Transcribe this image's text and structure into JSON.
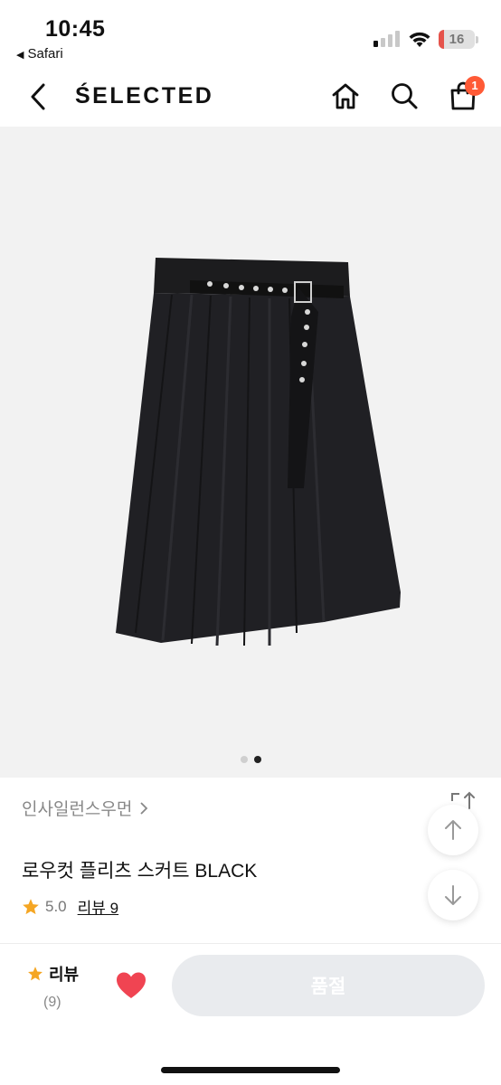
{
  "status_bar": {
    "time": "10:45",
    "back_app": "Safari",
    "battery": "16"
  },
  "header": {
    "brand": "ŚELECTED",
    "cart_badge": "1",
    "icons": [
      "chevron-left-icon",
      "home-icon",
      "search-icon",
      "shopping-bag-icon"
    ]
  },
  "gallery": {
    "image_desc_icon": "black-belted-pleated-skirt",
    "page_count": 2,
    "active_page": 2
  },
  "product": {
    "brand_link": "인사일런스우먼",
    "title": "로우컷 플리츠 스커트 BLACK",
    "rating": "5.0",
    "review_link": "리뷰 9"
  },
  "bottom_bar": {
    "review_label": "리뷰",
    "review_count": "(9)",
    "buy_label": "품절"
  },
  "colors": {
    "badge": "#ff5a36",
    "star": "#f5a623",
    "heart": "#f04452",
    "disabled_button": "#e9ebee"
  }
}
